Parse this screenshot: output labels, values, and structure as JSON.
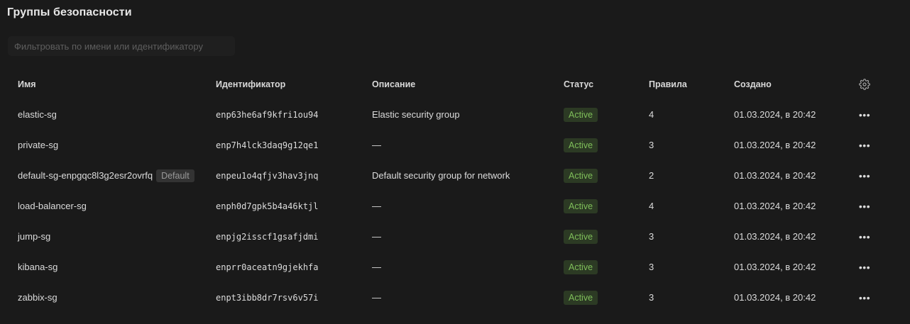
{
  "page": {
    "title": "Группы безопасности"
  },
  "filter": {
    "placeholder": "Фильтровать по имени или идентификатору",
    "value": ""
  },
  "table": {
    "columns": {
      "name": "Имя",
      "id": "Идентификатор",
      "description": "Описание",
      "status": "Статус",
      "rules": "Правила",
      "created": "Создано"
    },
    "rows": [
      {
        "name": "elastic-sg",
        "badge": "",
        "id": "enp63he6af9kfri1ou94",
        "description": "Elastic security group",
        "status": "Active",
        "rules": "4",
        "created": "01.03.2024, в 20:42"
      },
      {
        "name": "private-sg",
        "badge": "",
        "id": "enp7h4lck3daq9g12qe1",
        "description": "—",
        "status": "Active",
        "rules": "3",
        "created": "01.03.2024, в 20:42"
      },
      {
        "name": "default-sg-enpgqc8l3g2esr2ovrfq",
        "badge": "Default",
        "id": "enpeu1o4qfjv3hav3jnq",
        "description": "Default security group for network",
        "status": "Active",
        "rules": "2",
        "created": "01.03.2024, в 20:42"
      },
      {
        "name": "load-balancer-sg",
        "badge": "",
        "id": "enph0d7gpk5b4a46ktjl",
        "description": "—",
        "status": "Active",
        "rules": "4",
        "created": "01.03.2024, в 20:42"
      },
      {
        "name": "jump-sg",
        "badge": "",
        "id": "enpjg2isscf1gsafjdmi",
        "description": "—",
        "status": "Active",
        "rules": "3",
        "created": "01.03.2024, в 20:42"
      },
      {
        "name": "kibana-sg",
        "badge": "",
        "id": "enprr0aceatn9gjekhfa",
        "description": "—",
        "status": "Active",
        "rules": "3",
        "created": "01.03.2024, в 20:42"
      },
      {
        "name": "zabbix-sg",
        "badge": "",
        "id": "enpt3ibb8dr7rsv6v57i",
        "description": "—",
        "status": "Active",
        "rules": "3",
        "created": "01.03.2024, в 20:42"
      }
    ]
  },
  "icons": {
    "settings": "gear-icon",
    "row_actions": "more-horizontal-icon"
  },
  "colors": {
    "background": "#1a1a1a",
    "status_active_bg": "#2c3a24",
    "status_active_text": "#7fbf5a",
    "default_badge_bg": "#333333"
  }
}
